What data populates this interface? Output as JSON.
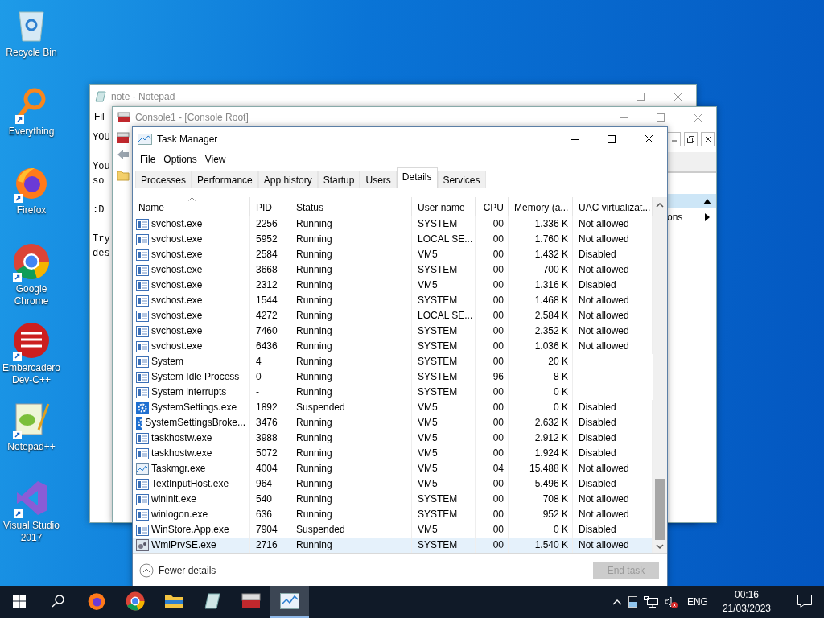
{
  "desktop_icons": [
    {
      "kind": "bin",
      "label": "Recycle Bin",
      "shortcut": false
    },
    {
      "kind": "search",
      "label": "Everything",
      "shortcut": true
    },
    {
      "kind": "firefox",
      "label": "Firefox",
      "shortcut": true
    },
    {
      "kind": "chrome",
      "label": "Google Chrome",
      "shortcut": true
    },
    {
      "kind": "dev",
      "label": "Embarcadero Dev-C++",
      "shortcut": true
    },
    {
      "kind": "notepad",
      "label": "Notepad++",
      "shortcut": true
    },
    {
      "kind": "vs",
      "label": "Visual Studio 2017",
      "shortcut": true
    }
  ],
  "notepad": {
    "title": "note - Notepad",
    "menu": [
      "Fil"
    ],
    "paragraphs": [
      [
        "YOU"
      ],
      [
        "You",
        "so"
      ],
      [
        ":D"
      ],
      [
        "Try",
        "des"
      ]
    ]
  },
  "console": {
    "title": "Console1 - [Console Root]",
    "pane_text": "ons"
  },
  "task_manager": {
    "title": "Task Manager",
    "menu": [
      "File",
      "Options",
      "View"
    ],
    "tabs": [
      {
        "label": "Processes",
        "selected": false
      },
      {
        "label": "Performance",
        "selected": false
      },
      {
        "label": "App history",
        "selected": false
      },
      {
        "label": "Startup",
        "selected": false
      },
      {
        "label": "Users",
        "selected": false
      },
      {
        "label": "Details",
        "selected": true
      },
      {
        "label": "Services",
        "selected": false
      }
    ],
    "columns": [
      "Name",
      "PID",
      "Status",
      "User name",
      "CPU",
      "Memory (a...",
      "UAC virtualizat..."
    ],
    "rows": [
      {
        "kind": "app",
        "selected": false,
        "cells": [
          "svchost.exe",
          "2256",
          "Running",
          "SYSTEM",
          "00",
          "1.336 K",
          "Not allowed"
        ]
      },
      {
        "kind": "app",
        "selected": false,
        "cells": [
          "svchost.exe",
          "5952",
          "Running",
          "LOCAL SE...",
          "00",
          "1.760 K",
          "Not allowed"
        ]
      },
      {
        "kind": "app",
        "selected": false,
        "cells": [
          "svchost.exe",
          "2584",
          "Running",
          "VM5",
          "00",
          "1.432 K",
          "Disabled"
        ]
      },
      {
        "kind": "app",
        "selected": false,
        "cells": [
          "svchost.exe",
          "3668",
          "Running",
          "SYSTEM",
          "00",
          "700 K",
          "Not allowed"
        ]
      },
      {
        "kind": "app",
        "selected": false,
        "cells": [
          "svchost.exe",
          "2312",
          "Running",
          "VM5",
          "00",
          "1.316 K",
          "Disabled"
        ]
      },
      {
        "kind": "app",
        "selected": false,
        "cells": [
          "svchost.exe",
          "1544",
          "Running",
          "SYSTEM",
          "00",
          "1.468 K",
          "Not allowed"
        ]
      },
      {
        "kind": "app",
        "selected": false,
        "cells": [
          "svchost.exe",
          "4272",
          "Running",
          "LOCAL SE...",
          "00",
          "2.584 K",
          "Not allowed"
        ]
      },
      {
        "kind": "app",
        "selected": false,
        "cells": [
          "svchost.exe",
          "7460",
          "Running",
          "SYSTEM",
          "00",
          "2.352 K",
          "Not allowed"
        ]
      },
      {
        "kind": "app",
        "selected": false,
        "cells": [
          "svchost.exe",
          "6436",
          "Running",
          "SYSTEM",
          "00",
          "1.036 K",
          "Not allowed"
        ]
      },
      {
        "kind": "app",
        "selected": false,
        "cells": [
          "System",
          "4",
          "Running",
          "SYSTEM",
          "00",
          "20 K"
        ]
      },
      {
        "kind": "app",
        "selected": false,
        "cells": [
          "System Idle Process",
          "0",
          "Running",
          "SYSTEM",
          "96",
          "8 K"
        ]
      },
      {
        "kind": "app",
        "selected": false,
        "cells": [
          "System interrupts",
          "-",
          "Running",
          "SYSTEM",
          "00",
          "0 K"
        ]
      },
      {
        "kind": "gear",
        "selected": false,
        "cells": [
          "SystemSettings.exe",
          "1892",
          "Suspended",
          "VM5",
          "00",
          "0 K",
          "Disabled"
        ]
      },
      {
        "kind": "gear",
        "selected": false,
        "cells": [
          "SystemSettingsBroke...",
          "3476",
          "Running",
          "VM5",
          "00",
          "2.632 K",
          "Disabled"
        ]
      },
      {
        "kind": "app",
        "selected": false,
        "cells": [
          "taskhostw.exe",
          "3988",
          "Running",
          "VM5",
          "00",
          "2.912 K",
          "Disabled"
        ]
      },
      {
        "kind": "app",
        "selected": false,
        "cells": [
          "taskhostw.exe",
          "5072",
          "Running",
          "VM5",
          "00",
          "1.924 K",
          "Disabled"
        ]
      },
      {
        "kind": "chart",
        "selected": false,
        "cells": [
          "Taskmgr.exe",
          "4004",
          "Running",
          "VM5",
          "04",
          "15.488 K",
          "Not allowed"
        ]
      },
      {
        "kind": "app",
        "selected": false,
        "cells": [
          "TextInputHost.exe",
          "964",
          "Running",
          "VM5",
          "00",
          "5.496 K",
          "Disabled"
        ]
      },
      {
        "kind": "app",
        "selected": false,
        "cells": [
          "wininit.exe",
          "540",
          "Running",
          "SYSTEM",
          "00",
          "708 K",
          "Not allowed"
        ]
      },
      {
        "kind": "app",
        "selected": false,
        "cells": [
          "winlogon.exe",
          "636",
          "Running",
          "SYSTEM",
          "00",
          "952 K",
          "Not allowed"
        ]
      },
      {
        "kind": "app",
        "selected": false,
        "cells": [
          "WinStore.App.exe",
          "7904",
          "Suspended",
          "VM5",
          "00",
          "0 K",
          "Disabled"
        ]
      },
      {
        "kind": "service",
        "selected": true,
        "cells": [
          "WmiPrvSE.exe",
          "2716",
          "Running",
          "SYSTEM",
          "00",
          "1.540 K",
          "Not allowed"
        ]
      }
    ],
    "fewer_details": "Fewer details",
    "end_task": {
      "label": "End task",
      "disabled": true
    }
  },
  "taskbar": {
    "apps": [
      {
        "kind": "firefox",
        "selected": false
      },
      {
        "kind": "chrome",
        "selected": false
      },
      {
        "kind": "explorer",
        "selected": false
      },
      {
        "kind": "notepad",
        "selected": false
      },
      {
        "kind": "console",
        "selected": false
      },
      {
        "kind": "taskmgr",
        "selected": true
      }
    ],
    "language": "ENG",
    "time": "00:16",
    "date": "21/03/2023"
  }
}
